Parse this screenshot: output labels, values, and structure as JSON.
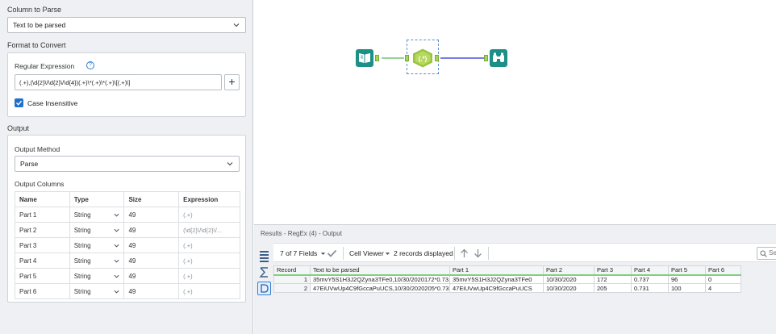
{
  "config": {
    "column_to_parse_label": "Column to Parse",
    "column_to_parse_value": "Text to be parsed",
    "format_label": "Format to Convert",
    "regex_label": "Regular Expression",
    "regex_value": "(.+),(\\d{2}\\/\\d{2}\\/\\d{4})(.+)\\*(.+)\\*(.+)\\[(.+)\\]",
    "help_glyph": "?",
    "add_glyph": "+",
    "case_insensitive_label": "Case Insensitive",
    "case_insensitive_checked": true,
    "output_label": "Output",
    "output_method_label": "Output Method",
    "output_method_value": "Parse",
    "output_columns_label": "Output Columns",
    "columns_headers": [
      "Name",
      "Type",
      "Size",
      "Expression"
    ],
    "columns": [
      {
        "name": "Part 1",
        "type": "String",
        "size": "49",
        "expr": "(.+)"
      },
      {
        "name": "Part 2",
        "type": "String",
        "size": "49",
        "expr": "(\\d{2}\\/\\d{2}\\/..."
      },
      {
        "name": "Part 3",
        "type": "String",
        "size": "49",
        "expr": "(.+)"
      },
      {
        "name": "Part 4",
        "type": "String",
        "size": "49",
        "expr": "(.+)"
      },
      {
        "name": "Part 5",
        "type": "String",
        "size": "49",
        "expr": "(.+)"
      },
      {
        "name": "Part 6",
        "type": "String",
        "size": "49",
        "expr": "(.+)"
      }
    ]
  },
  "canvas": {
    "regex_tool_glyph": "(.*)",
    "accent_teal": "#1c8f86",
    "connector_green": "#5cb85c",
    "connector_blue": "#2b2fd6",
    "icons": [
      "input-book-icon",
      "regex-tool-icon",
      "browse-binoculars-icon"
    ]
  },
  "results": {
    "title": "Results - RegEx (4) - Output",
    "fields_count": "7 of 7 Fields",
    "cell_viewer": "Cell Viewer",
    "records_displayed": "2 records displayed",
    "search_placeholder": "Search",
    "headers": [
      "Record",
      "Text to be parsed",
      "Part 1",
      "Part 2",
      "Part 3",
      "Part 4",
      "Part 5",
      "Part 6"
    ],
    "rows": [
      [
        "1",
        "35mvY5S1H3J2QZyna3TFe0,10/30/2020172*0.73...",
        "35mvY5S1H3J2QZyna3TFe0",
        "10/30/2020",
        "172",
        "0.737",
        "96",
        "0"
      ],
      [
        "2",
        "47EiUVwUp4C9fGccaPuUCS,10/30/2020205*0.73...",
        "47EiUVwUp4C9fGccaPuUCS",
        "10/30/2020",
        "205",
        "0.731",
        "100",
        "4"
      ]
    ]
  }
}
